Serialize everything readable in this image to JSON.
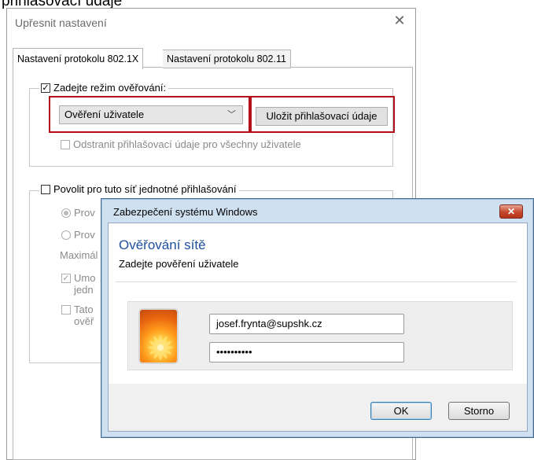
{
  "caption_top": "přihlašovací údaje",
  "dialog": {
    "title": "Upřesnit nastavení",
    "close_glyph": "✕",
    "tabs": [
      {
        "label": "Nastavení protokolu 802.1X"
      },
      {
        "label": "Nastavení protokolu 802.11"
      }
    ],
    "auth_mode": {
      "checkbox_label": "Zadejte režim ověřování:",
      "checked": true,
      "select_value": "Ověření uživatele",
      "save_button": "Uložit přihlašovací údaje",
      "remove_label": "Odstranit přihlašovací údaje pro všechny uživatele"
    },
    "sso": {
      "checkbox_label": "Povolit pro tuto síť jednotné přihlašování",
      "radio1": "Prov",
      "radio2": "Prov",
      "max_label": "Maximál",
      "cb1_line1": "Umo",
      "cb1_line2": "jedn",
      "cb2_line1": "Tato",
      "cb2_line2": "ověř"
    }
  },
  "security_dialog": {
    "title": "Zabezpečení systému Windows",
    "close_glyph": "✕",
    "heading": "Ověřování sítě",
    "subheading": "Zadejte pověření uživatele",
    "username": "josef.frynta@supshk.cz",
    "password": "••••••••••",
    "ok_button": "OK",
    "cancel_button": "Storno"
  },
  "colors": {
    "highlight_red": "#b2101a",
    "heading_blue": "#1e4f9c",
    "frame_blue": "#cfe0f1"
  }
}
